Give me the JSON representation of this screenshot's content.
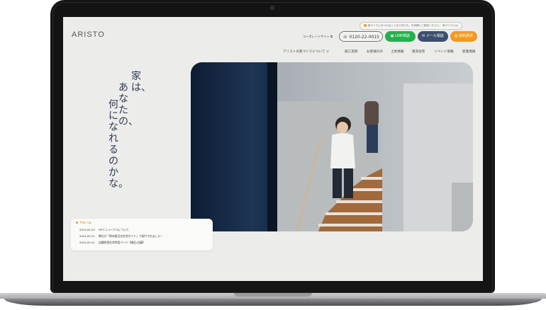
{
  "header": {
    "logo": "ARISTO",
    "notice": "家づくりにまつわることなら何でも、お気軽にご相談ください。 家づくりには",
    "corporate_link": "コーポレートサイト",
    "tel_button": "0120-22-0015",
    "line_button": "LINE相談",
    "mail_button": "メール相談",
    "doc_button": "資料請求"
  },
  "nav": {
    "items": [
      "アリストの家づくりについて",
      "施工実例",
      "お客様の声",
      "土地情報",
      "建売住宅",
      "イベント情報",
      "新着情報"
    ]
  },
  "hero": {
    "tagline_col1": "家は、",
    "tagline_col2": "あなたの、",
    "tagline_col3": "何になれるのかな。"
  },
  "pickup": {
    "title": "Pick Up",
    "news": [
      {
        "date": "2024.05.20",
        "text": "HPリニューアルについて"
      },
      {
        "date": "2024.05.21",
        "text": "弊社が『熊本県注文住宅ガイド』で紹介されました！"
      },
      {
        "date": "2024.05.21",
        "text": "店舗併用住宅特設ページ【南区/白藤】"
      }
    ]
  },
  "colors": {
    "line_green": "#22b14c",
    "mail_navy": "#3c4f6e",
    "doc_orange": "#f39a1e",
    "tagline_navy": "#2d3a57"
  }
}
